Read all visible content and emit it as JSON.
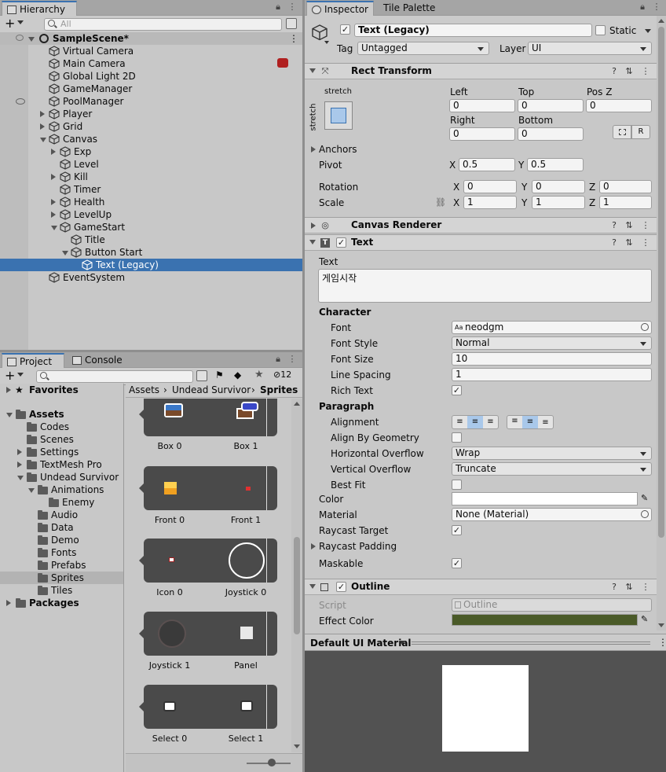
{
  "hierarchy": {
    "tab_label": "Hierarchy",
    "search_placeholder": "All",
    "scene_name": "SampleScene*",
    "items": [
      {
        "label": "Virtual Camera"
      },
      {
        "label": "Main Camera"
      },
      {
        "label": "Global Light 2D"
      },
      {
        "label": "GameManager"
      },
      {
        "label": "PoolManager"
      },
      {
        "label": "Player"
      },
      {
        "label": "Grid"
      },
      {
        "label": "Canvas"
      },
      {
        "label": "Exp"
      },
      {
        "label": "Level"
      },
      {
        "label": "Kill"
      },
      {
        "label": "Timer"
      },
      {
        "label": "Health"
      },
      {
        "label": "LevelUp"
      },
      {
        "label": "GameStart"
      },
      {
        "label": "Title"
      },
      {
        "label": "Button Start"
      },
      {
        "label": "Text (Legacy)"
      },
      {
        "label": "EventSystem"
      }
    ]
  },
  "project": {
    "tab_label": "Project",
    "console_tab_label": "Console",
    "hidden_count": "12",
    "breadcrumb": [
      "Assets",
      "Undead Survivor",
      "Sprites"
    ],
    "tree": [
      {
        "label": "Favorites"
      },
      {
        "label": "Assets"
      },
      {
        "label": "Codes"
      },
      {
        "label": "Scenes"
      },
      {
        "label": "Settings"
      },
      {
        "label": "TextMesh Pro"
      },
      {
        "label": "Undead Survivor"
      },
      {
        "label": "Animations"
      },
      {
        "label": "Enemy"
      },
      {
        "label": "Audio"
      },
      {
        "label": "Data"
      },
      {
        "label": "Demo"
      },
      {
        "label": "Fonts"
      },
      {
        "label": "Prefabs"
      },
      {
        "label": "Sprites"
      },
      {
        "label": "Tiles"
      },
      {
        "label": "Packages"
      }
    ],
    "sprites": [
      {
        "left": "Box 0",
        "right": "Box 1"
      },
      {
        "left": "Front 0",
        "right": "Front 1"
      },
      {
        "left": "Icon 0",
        "right": "Joystick 0"
      },
      {
        "left": "Joystick 1",
        "right": "Panel"
      },
      {
        "left": "Select 0",
        "right": "Select 1"
      }
    ]
  },
  "inspector": {
    "tab_label": "Inspector",
    "tile_palette_label": "Tile Palette",
    "object_name": "Text (Legacy)",
    "static_label": "Static",
    "tag_label": "Tag",
    "tag_value": "Untagged",
    "layer_label": "Layer",
    "layer_value": "UI",
    "rect_transform": {
      "title": "Rect Transform",
      "anchor_top": "stretch",
      "anchor_side": "stretch",
      "left_label": "Left",
      "left": "0",
      "top_label": "Top",
      "top": "0",
      "posz_label": "Pos Z",
      "posz": "0",
      "right_label": "Right",
      "right": "0",
      "bottom_label": "Bottom",
      "bottom": "0",
      "r_button": "R",
      "anchors_label": "Anchors",
      "pivot_label": "Pivot",
      "pivot_x": "0.5",
      "pivot_y": "0.5",
      "rotation_label": "Rotation",
      "rot_x": "0",
      "rot_y": "0",
      "rot_z": "0",
      "scale_label": "Scale",
      "scale_x": "1",
      "scale_y": "1",
      "scale_z": "1",
      "x": "X",
      "y": "Y",
      "z": "Z"
    },
    "canvas_renderer": {
      "title": "Canvas Renderer"
    },
    "text": {
      "title": "Text",
      "text_label": "Text",
      "text_value": "게임시작",
      "character_label": "Character",
      "font_label": "Font",
      "font_value": "neodgm",
      "font_style_label": "Font Style",
      "font_style_value": "Normal",
      "font_size_label": "Font Size",
      "font_size_value": "10",
      "line_spacing_label": "Line Spacing",
      "line_spacing_value": "1",
      "rich_text_label": "Rich Text",
      "paragraph_label": "Paragraph",
      "alignment_label": "Alignment",
      "align_geometry_label": "Align By Geometry",
      "h_overflow_label": "Horizontal Overflow",
      "h_overflow_value": "Wrap",
      "v_overflow_label": "Vertical Overflow",
      "v_overflow_value": "Truncate",
      "best_fit_label": "Best Fit",
      "color_label": "Color",
      "material_label": "Material",
      "material_value": "None (Material)",
      "raycast_target_label": "Raycast Target",
      "raycast_padding_label": "Raycast Padding",
      "maskable_label": "Maskable"
    },
    "outline": {
      "title": "Outline",
      "script_label": "Script",
      "script_value": "Outline",
      "effect_color_label": "Effect Color",
      "effect_color": "#4a5a28"
    },
    "preview": {
      "material_label": "Default UI Material"
    }
  },
  "colors": {
    "accent": "#3a72b0",
    "panel": "#c8c8c8",
    "sprite_bg": "#4a4a4a"
  }
}
